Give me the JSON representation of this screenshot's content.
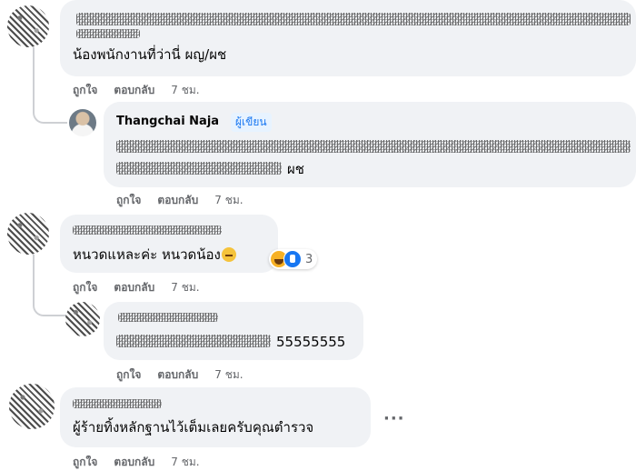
{
  "comments": [
    {
      "author": "",
      "text": "น้องพนักงานที่ว่านี่ ผญ/ผช",
      "actions": {
        "like": "ถูกใจ",
        "reply": "ตอบกลับ",
        "time": "7 ชม."
      }
    },
    {
      "author": "Thangchai Naja",
      "badge": "ผู้เขียน",
      "text_suffix": "ผช",
      "actions": {
        "like": "ถูกใจ",
        "reply": "ตอบกลับ",
        "time": "7 ชม."
      }
    },
    {
      "author": "",
      "text": "หนวดแหละค่ะ หนวดน้อง",
      "emoji": "weary-face-emoji",
      "reactions": {
        "icons": [
          "haha-reaction",
          "like-reaction"
        ],
        "count": "3"
      },
      "actions": {
        "like": "ถูกใจ",
        "reply": "ตอบกลับ",
        "time": "7 ชม."
      }
    },
    {
      "author": "",
      "text_suffix": "55555555",
      "actions": {
        "like": "ถูกใจ",
        "reply": "ตอบกลับ",
        "time": "7 ชม."
      }
    },
    {
      "author": "",
      "text": "ผู้ร้ายทิ้งหลักฐานไว้เต็มเลยครับคุณตำรวจ",
      "more": "···",
      "actions": {
        "like": "ถูกใจ",
        "reply": "ตอบกลับ",
        "time": "7 ชม."
      }
    }
  ],
  "colors": {
    "bubble": "#f0f2f5",
    "meta": "#65676b",
    "accent": "#1877f2"
  }
}
